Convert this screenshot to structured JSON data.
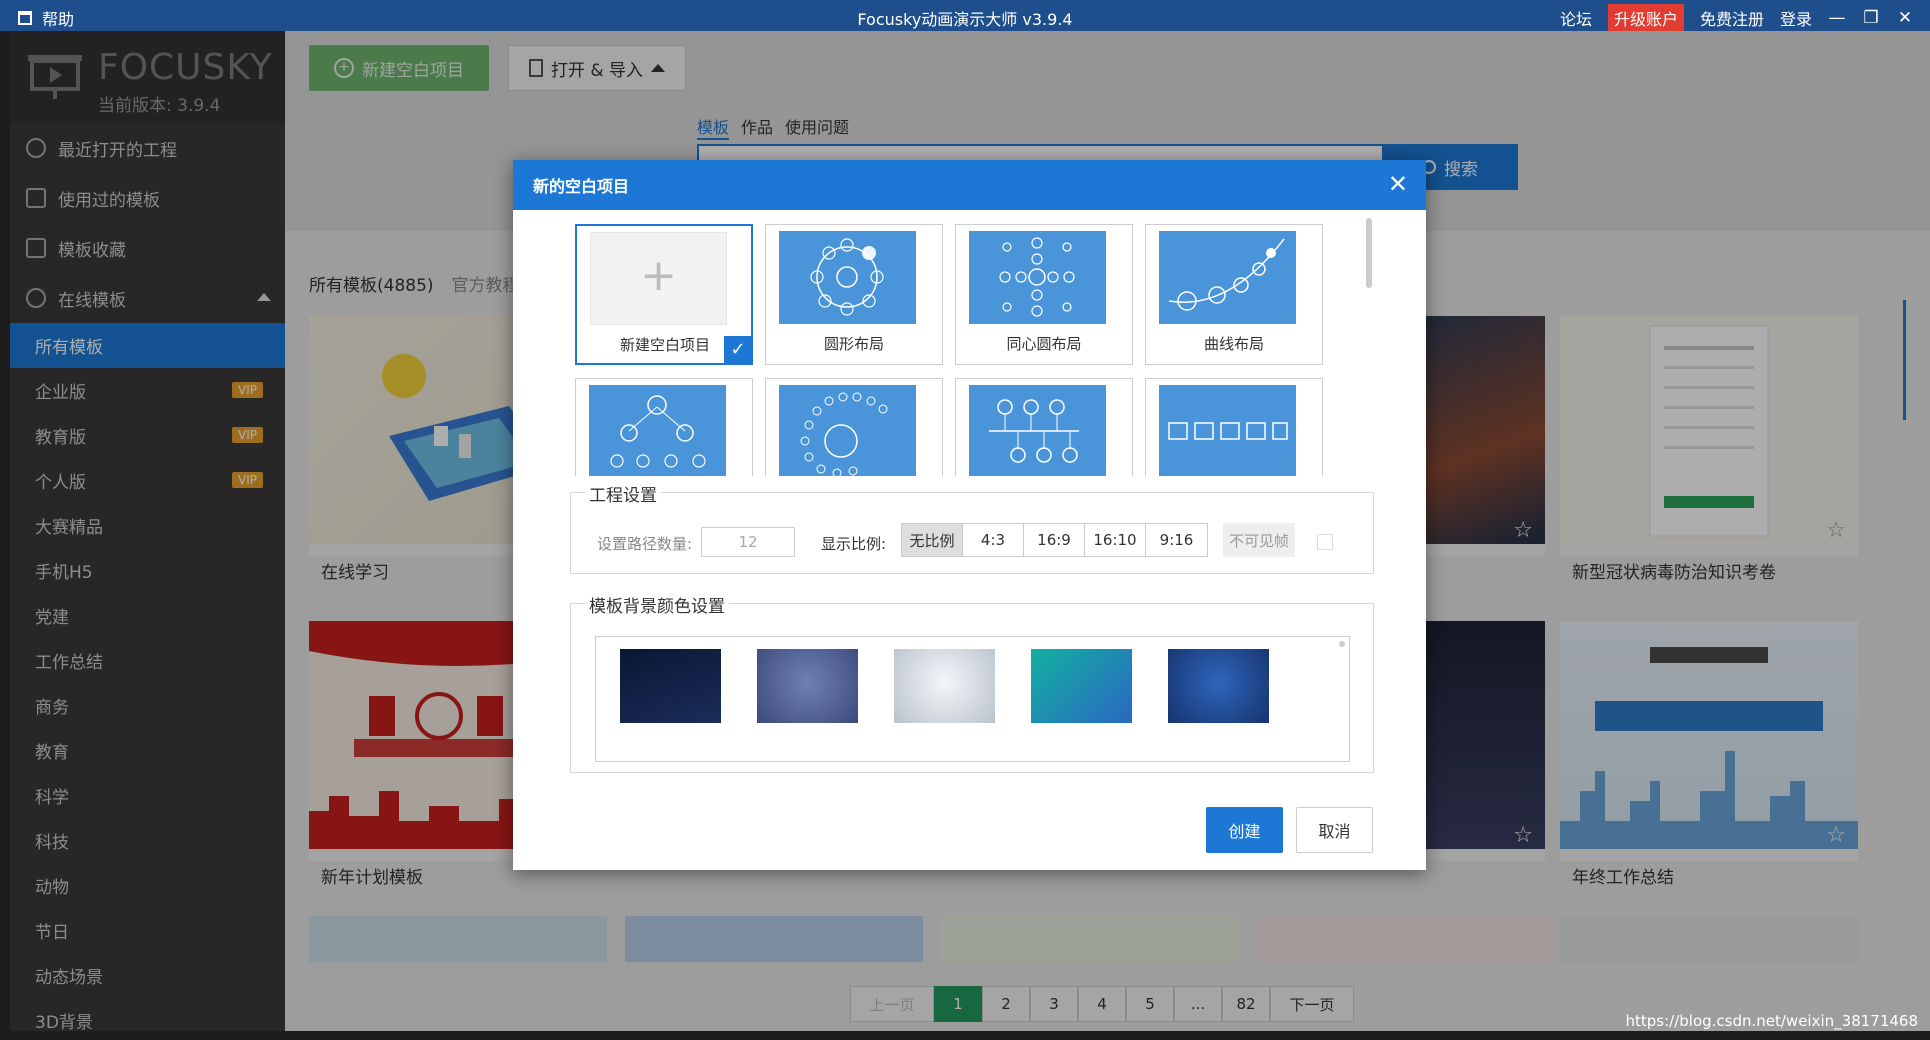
{
  "titlebar": {
    "help": "帮助",
    "title": "Focusky动画演示大师 v3.9.4",
    "forum": "论坛",
    "upgrade": "升级账户",
    "register": "免费注册",
    "login": "登录"
  },
  "sidebar": {
    "logo_text": "FOCUSKY",
    "version": "当前版本: 3.9.4",
    "items": [
      {
        "label": "最近打开的工程",
        "icon": "clock-icon"
      },
      {
        "label": "使用过的模板",
        "icon": "template-icon"
      },
      {
        "label": "模板收藏",
        "icon": "favorite-folder-icon"
      },
      {
        "label": "在线模板",
        "icon": "cloud-icon"
      }
    ],
    "categories": [
      {
        "label": "所有模板"
      },
      {
        "label": "企业版",
        "badge": "VIP"
      },
      {
        "label": "教育版",
        "badge": "VIP"
      },
      {
        "label": "个人版",
        "badge": "VIP"
      },
      {
        "label": "大赛精品"
      },
      {
        "label": "手机H5"
      },
      {
        "label": "党建"
      },
      {
        "label": "工作总结"
      },
      {
        "label": "商务"
      },
      {
        "label": "教育"
      },
      {
        "label": "科学"
      },
      {
        "label": "科技"
      },
      {
        "label": "动物"
      },
      {
        "label": "节日"
      },
      {
        "label": "动态场景"
      },
      {
        "label": "3D背景"
      }
    ]
  },
  "toolbar": {
    "new_label": "新建空白项目",
    "open_label": "打开 & 导入"
  },
  "search": {
    "tabs": [
      "模板",
      "作品",
      "使用问题"
    ],
    "button": "搜索"
  },
  "filters": {
    "all": "所有模板(4885)",
    "official": "官方教程"
  },
  "cards": [
    {
      "caption": "在线学习"
    },
    {
      "caption": "新型冠状病毒防治知识考卷"
    },
    {
      "caption": "新年计划模板"
    },
    {
      "caption": "年终工作总结"
    }
  ],
  "pager": {
    "prev": "上一页",
    "pages": [
      "1",
      "2",
      "3",
      "4",
      "5",
      "...",
      "82"
    ],
    "next": "下一页",
    "current": "1"
  },
  "watermark": "https://blog.csdn.net/weixin_38171468",
  "dialog": {
    "title": "新的空白项目",
    "layouts": [
      {
        "label": "新建空白项目",
        "selected": true
      },
      {
        "label": "圆形布局"
      },
      {
        "label": "同心圆布局"
      },
      {
        "label": "曲线布局"
      }
    ],
    "project_settings": {
      "legend": "工程设置",
      "path_count_label": "设置路径数量:",
      "path_count_value": "12",
      "ratio_label": "显示比例:",
      "ratios": [
        "无比例",
        "4:3",
        "16:9",
        "16:10",
        "9:16"
      ],
      "selected_ratio": "无比例",
      "invisible_frame": "不可见帧"
    },
    "bg_settings": {
      "legend": "模板背景颜色设置",
      "swatches": [
        "#0e1e45",
        "#4a5c8e",
        "#d6dbe0",
        "#1aa0a3",
        "#1f4f9a"
      ]
    },
    "create": "创建",
    "cancel": "取消"
  },
  "colors": {
    "accent": "#1c78d4",
    "titlebar": "#1e4f8c",
    "sidebar": "#3a3a3a",
    "new_button": "#6fb56f",
    "pager_current": "#229a61",
    "upgrade": "#e03c31"
  }
}
